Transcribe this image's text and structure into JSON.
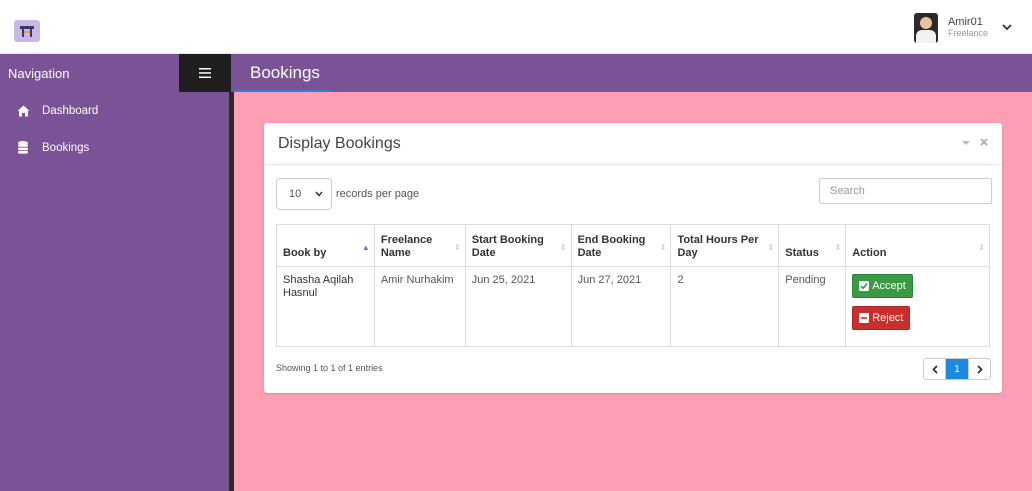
{
  "topbar": {
    "user_name": "Amir01",
    "user_role": "Freelance"
  },
  "sidebar": {
    "title": "Navigation",
    "items": [
      {
        "label": "Dashboard",
        "icon": "home-icon"
      },
      {
        "label": "Bookings",
        "icon": "database-icon"
      }
    ]
  },
  "page": {
    "title": "Bookings"
  },
  "panel": {
    "title": "Display Bookings",
    "length_value": "10",
    "length_label": "records per page",
    "search_placeholder": "Search",
    "columns": [
      "Book by",
      "Freelance Name",
      "Start Booking Date",
      "End Booking Date",
      "Total Hours Per Day",
      "Status",
      "Action"
    ],
    "rows": [
      {
        "book_by": "Shasha Aqilah Hasnul",
        "freelance_name": "Amir Nurhakim",
        "start_date": "Jun 25, 2021",
        "end_date": "Jun 27, 2021",
        "hours": "2",
        "status": "Pending",
        "accept_label": "Accept",
        "reject_label": "Reject"
      }
    ],
    "info": "Showing 1 to 1 of 1 entries",
    "pagination": {
      "prev": "‹",
      "current": "1",
      "next": "›"
    }
  },
  "colors": {
    "sidebar": "#7a5296",
    "content_bg": "#ff9eb4",
    "accept": "#3a9a43",
    "reject": "#c9302c",
    "page_active": "#1a8be0"
  }
}
